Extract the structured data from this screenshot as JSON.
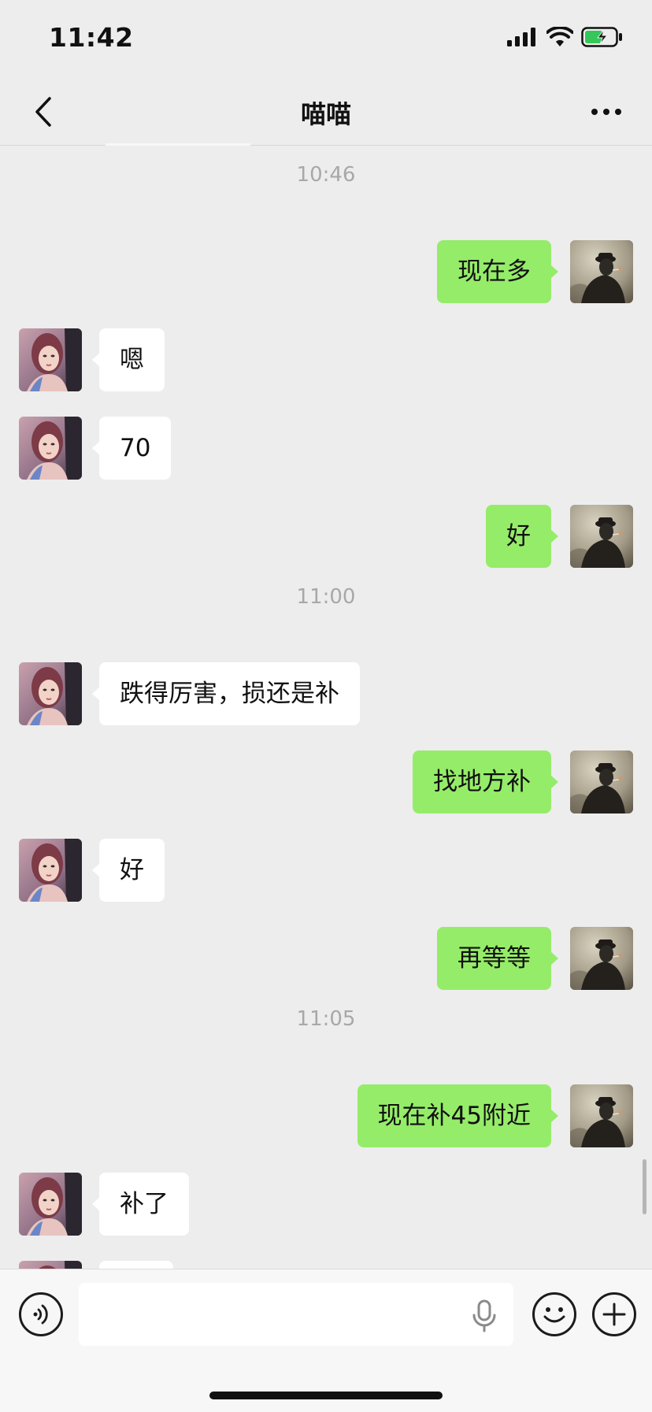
{
  "status_bar": {
    "time": "11:42"
  },
  "header": {
    "title": "喵喵",
    "back_icon": "chevron-left-icon",
    "more_icon": "ellipsis-icon"
  },
  "chat": {
    "timestamps": [
      "10:46",
      "11:00",
      "11:05"
    ],
    "messages": [
      {
        "side": "out",
        "text": "现在多"
      },
      {
        "side": "in",
        "text": "嗯"
      },
      {
        "side": "in",
        "text": "70"
      },
      {
        "side": "out",
        "text": "好"
      },
      {
        "side": "in",
        "text": "跌得厉害，损还是补"
      },
      {
        "side": "out",
        "text": "找地方补"
      },
      {
        "side": "in",
        "text": "好"
      },
      {
        "side": "out",
        "text": "再等等"
      },
      {
        "side": "out",
        "text": "现在补45附近"
      },
      {
        "side": "in",
        "text": "补了"
      },
      {
        "side": "in",
        "text": ""
      }
    ]
  },
  "input_bar": {
    "placeholder": "",
    "voice_icon": "voice-icon",
    "mic_icon": "microphone-icon",
    "emoji_icon": "emoji-icon",
    "plus_icon": "plus-icon"
  },
  "colors": {
    "background": "#ededed",
    "outgoing_bubble": "#95ec69",
    "incoming_bubble": "#ffffff",
    "timestamp": "#a8a8a8"
  }
}
